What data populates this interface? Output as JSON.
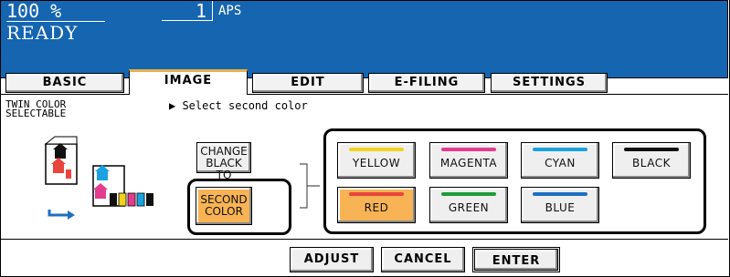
{
  "status": {
    "zoom": "100  %",
    "copies": "1",
    "paper_mode": "APS",
    "state": "READY"
  },
  "tabs": [
    {
      "label": "BASIC",
      "active": false
    },
    {
      "label": "IMAGE",
      "active": true
    },
    {
      "label": "EDIT",
      "active": false
    },
    {
      "label": "E-FILING",
      "active": false
    },
    {
      "label": "SETTINGS",
      "active": false
    }
  ],
  "subtitle": {
    "line1": "TWIN COLOR",
    "line2": "SELECTABLE"
  },
  "prompt": "▶ Select second color",
  "change_black_to": {
    "line1": "CHANGE",
    "line2": "BLACK TO"
  },
  "second_color": {
    "line1": "SECOND",
    "line2": "COLOR"
  },
  "colors": [
    {
      "label": "YELLOW",
      "color": "#f0d21e"
    },
    {
      "label": "MAGENTA",
      "color": "#e23d8f"
    },
    {
      "label": "CYAN",
      "color": "#1aa3e0"
    },
    {
      "label": "BLACK",
      "color": "#111111"
    },
    {
      "label": "RED",
      "color": "#e8453c",
      "selected": true
    },
    {
      "label": "GREEN",
      "color": "#1f9b3a"
    },
    {
      "label": "BLUE",
      "color": "#1e6fc0"
    }
  ],
  "actions": {
    "adjust": "ADJUST",
    "cancel": "CANCEL",
    "enter": "ENTER"
  }
}
